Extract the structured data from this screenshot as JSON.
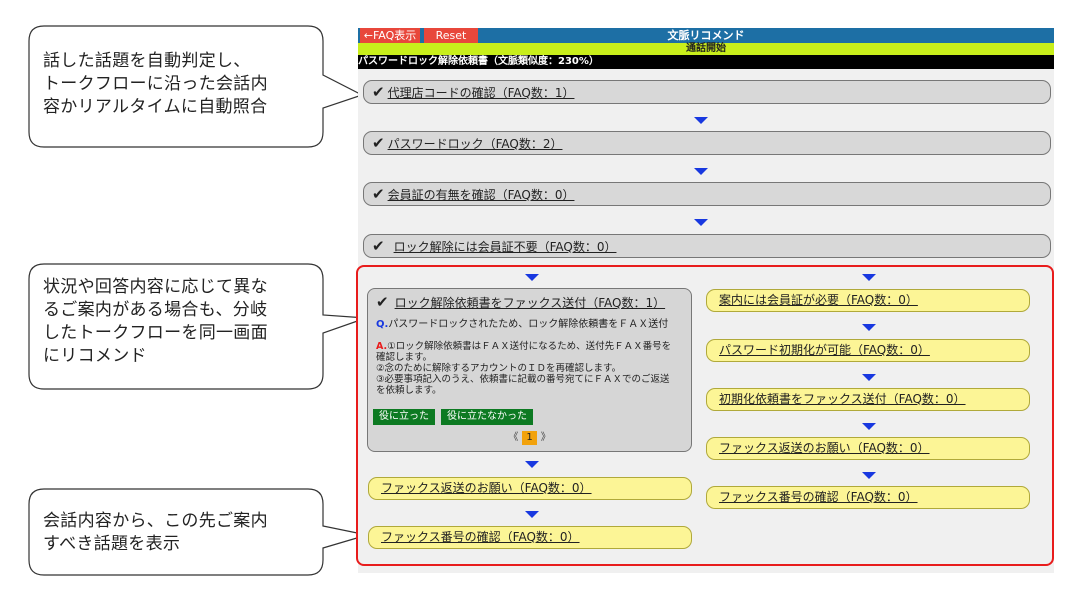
{
  "callouts": {
    "one": [
      "話した話題を自動判定し、",
      "トークフローに沿った会話内",
      "容かリアルタイムに自動照合"
    ],
    "two": [
      "状況や回答内容に応じて異な",
      "るご案内がある場合も、分岐",
      "したトークフローを同一画面",
      "にリコメンド"
    ],
    "three": [
      "会話内容から、この先ご案内",
      "すべき話題を表示"
    ]
  },
  "app": {
    "faq_button": "←FAQ表示",
    "reset_button": "Reset",
    "title": "文脈リコメンド",
    "status": "通話開始",
    "document": "パスワードロック解除依頼書（文脈類似度：230%）"
  },
  "flow": [
    {
      "check": "✔",
      "label": "代理店コードの確認（FAQ数：1）"
    },
    {
      "check": "✔",
      "label": "パスワードロック（FAQ数：2）"
    },
    {
      "check": "✔",
      "label": "会員証の有無を確認（FAQ数：0）"
    },
    {
      "check": "✔",
      "label": "ロック解除には会員証不要（FAQ数：0）"
    }
  ],
  "detail": {
    "check": "✔",
    "label": "ロック解除依頼書をファックス送付（FAQ数：1）",
    "q_mark": "Q.",
    "question": "パスワードロックされたため、ロック解除依頼書をＦＡＸ送付",
    "a_mark": "A.",
    "answer": [
      "①ロック解除依頼書はＦＡＸ送付になるため、送付先ＦＡＸ番号を",
      "確認します。",
      "②念のために解除するアカウントのＩＤを再確認します。",
      "③必要事項記入のうえ、依頼書に記載の番号宛てにＦＡＸでのご返送",
      "を依頼します。"
    ],
    "helpful": "役に立った",
    "not_helpful": "役に立たなかった",
    "pager_prev": "《",
    "pager_page": "1",
    "pager_next": "》"
  },
  "left_branch": [
    "ファックス返送のお願い（FAQ数：0）",
    "ファックス番号の確認（FAQ数：0）"
  ],
  "right_branch": [
    "案内には会員証が必要（FAQ数：0）",
    "パスワード初期化が可能（FAQ数：0）",
    "初期化依頼書をファックス送付（FAQ数：0）",
    "ファックス返送のお願い（FAQ数：0）",
    "ファックス番号の確認（FAQ数：0）"
  ],
  "colors": {
    "topbar": "#1d6fa5",
    "button_red": "#e8473b",
    "status_green": "#c8ee1b",
    "arrow_blue": "#1838e0",
    "branch_border": "#e81c1c",
    "pill_yellow": "#fcf596",
    "feedback_green": "#0d7a22",
    "pager_orange": "#f2a20c"
  }
}
